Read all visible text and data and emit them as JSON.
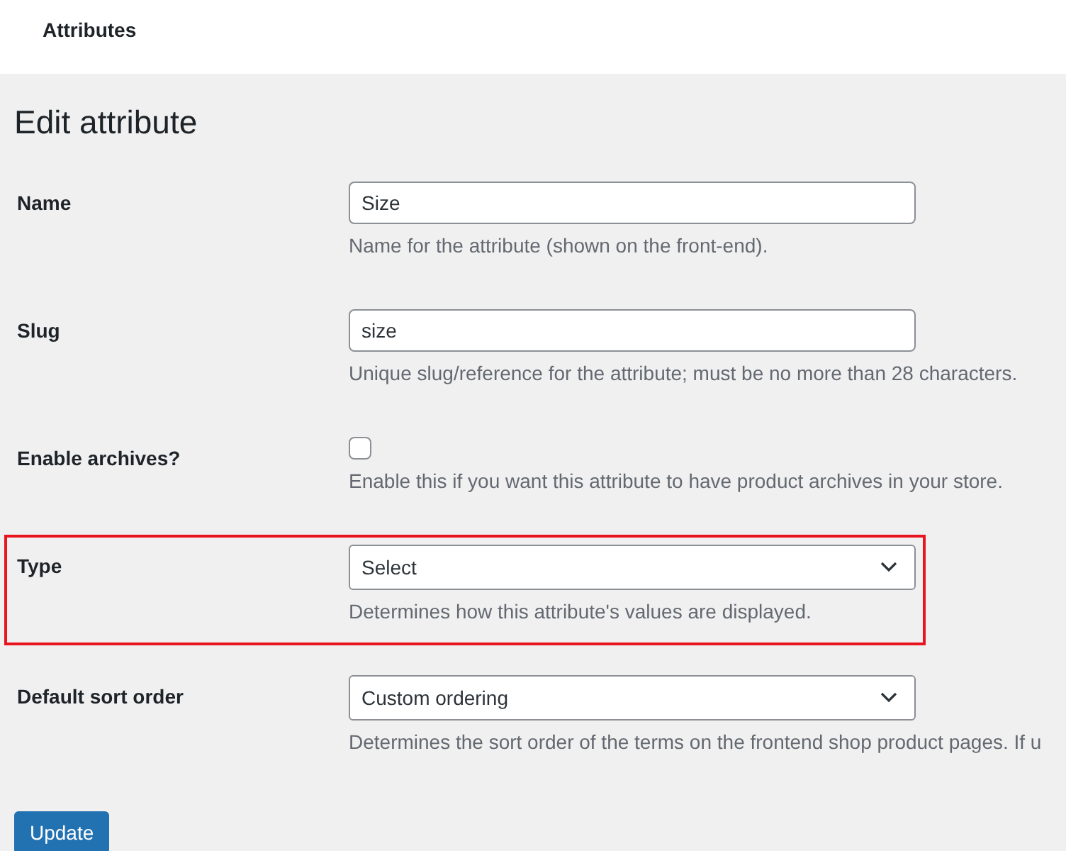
{
  "top_bar": {
    "title": "Attributes"
  },
  "heading": "Edit attribute",
  "fields": [
    {
      "kind": "text",
      "label": "Name",
      "value": "Size",
      "description": "Name for the attribute (shown on the front-end).",
      "highlighted": false
    },
    {
      "kind": "text",
      "label": "Slug",
      "value": "size",
      "description": "Unique slug/reference for the attribute; must be no more than 28 characters.",
      "highlighted": false
    },
    {
      "kind": "checkbox",
      "label": "Enable archives?",
      "checked": false,
      "description": "Enable this if you want this attribute to have product archives in your store.",
      "highlighted": false
    },
    {
      "kind": "select",
      "label": "Type",
      "value": "Select",
      "description": "Determines how this attribute's values are displayed.",
      "highlighted": true
    },
    {
      "kind": "select",
      "label": "Default sort order",
      "value": "Custom ordering",
      "description": "Determines the sort order of the terms on the frontend shop product pages. If u",
      "highlighted": false
    }
  ],
  "button": "Update"
}
